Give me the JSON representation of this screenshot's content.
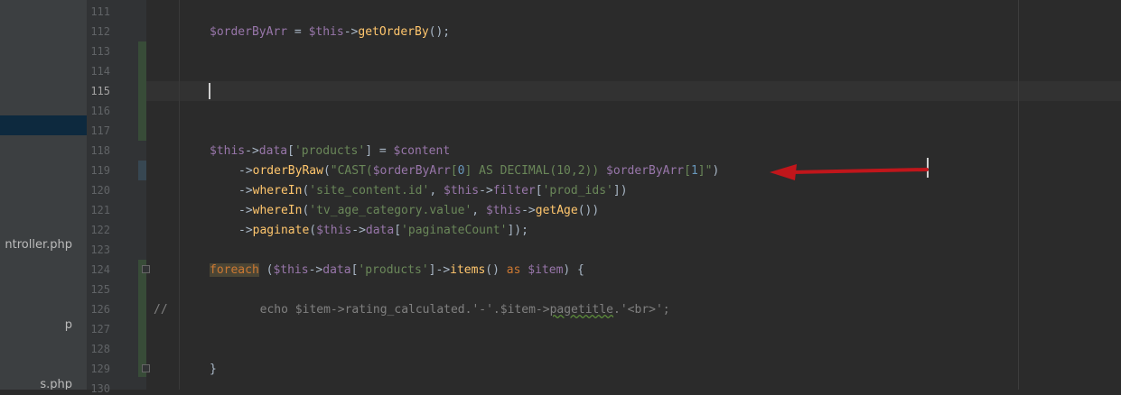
{
  "project_tree": {
    "items": [
      {
        "label": "ntroller.php"
      },
      {
        "label": "p"
      },
      {
        "label": "s.php"
      }
    ]
  },
  "editor": {
    "line_numbers": [
      "111",
      "112",
      "113",
      "114",
      "115",
      "116",
      "117",
      "118",
      "119",
      "120",
      "121",
      "122",
      "123",
      "124",
      "125",
      "126",
      "127",
      "128",
      "129",
      "130"
    ],
    "active_line": "115",
    "code": {
      "l112": {
        "var1": "$orderByArr",
        "op1": " = ",
        "var2": "$this",
        "op2": "->",
        "fn1": "getOrderBy",
        "rest": "();"
      },
      "l118": {
        "var1": "$this",
        "op1": "->",
        "prop": "data",
        "b1": "[",
        "str1": "'products'",
        "b2": "] = ",
        "var2": "$content"
      },
      "l119": {
        "op1": "->",
        "fn1": "orderByRaw",
        "p1": "(",
        "str1": "\"CAST(",
        "var1": "$orderByArr",
        "b1": "[",
        "num1": "0",
        "b2": "]",
        "str2": " AS DECIMAL(10,2)) ",
        "var2": "$orderByArr",
        "b3": "[",
        "num2": "1",
        "b4": "]",
        "str3": "\"",
        "p2": ")"
      },
      "l120": {
        "op1": "->",
        "fn1": "whereIn",
        "p1": "(",
        "str1": "'site_content.id'",
        "sep": ", ",
        "var1": "$this",
        "op2": "->",
        "prop": "filter",
        "b1": "[",
        "str2": "'prod_ids'",
        "b2": "])"
      },
      "l121": {
        "op1": "->",
        "fn1": "whereIn",
        "p1": "(",
        "str1": "'tv_age_category.value'",
        "sep": ", ",
        "var1": "$this",
        "op2": "->",
        "fn2": "getAge",
        "p2": "())"
      },
      "l122": {
        "op1": "->",
        "fn1": "paginate",
        "p1": "(",
        "var1": "$this",
        "op2": "->",
        "prop": "data",
        "b1": "[",
        "str1": "'paginateCount'",
        "b2": "]);"
      },
      "l124": {
        "kw": "foreach",
        "p1": " (",
        "var1": "$this",
        "op1": "->",
        "prop": "data",
        "b1": "[",
        "str1": "'products'",
        "b2": "]->",
        "fn1": "items",
        "p2": "() ",
        "kw2": "as",
        "sp": " ",
        "var2": "$item",
        "p3": ") {"
      },
      "l126": {
        "comment_start": "//",
        "text_a": "echo $item->rating_calculated.'-'.$item->",
        "text_b": "pagetitle",
        "text_c": ".'<br>';"
      },
      "l129": {
        "brace": "}"
      }
    }
  },
  "annotation": {
    "color": "#c0161b"
  },
  "colors": {
    "background": "#2b2b2b",
    "keyword": "#cc7832",
    "variable": "#9876aa",
    "function": "#ffc66d",
    "string": "#6a8759",
    "number": "#6897bb"
  }
}
